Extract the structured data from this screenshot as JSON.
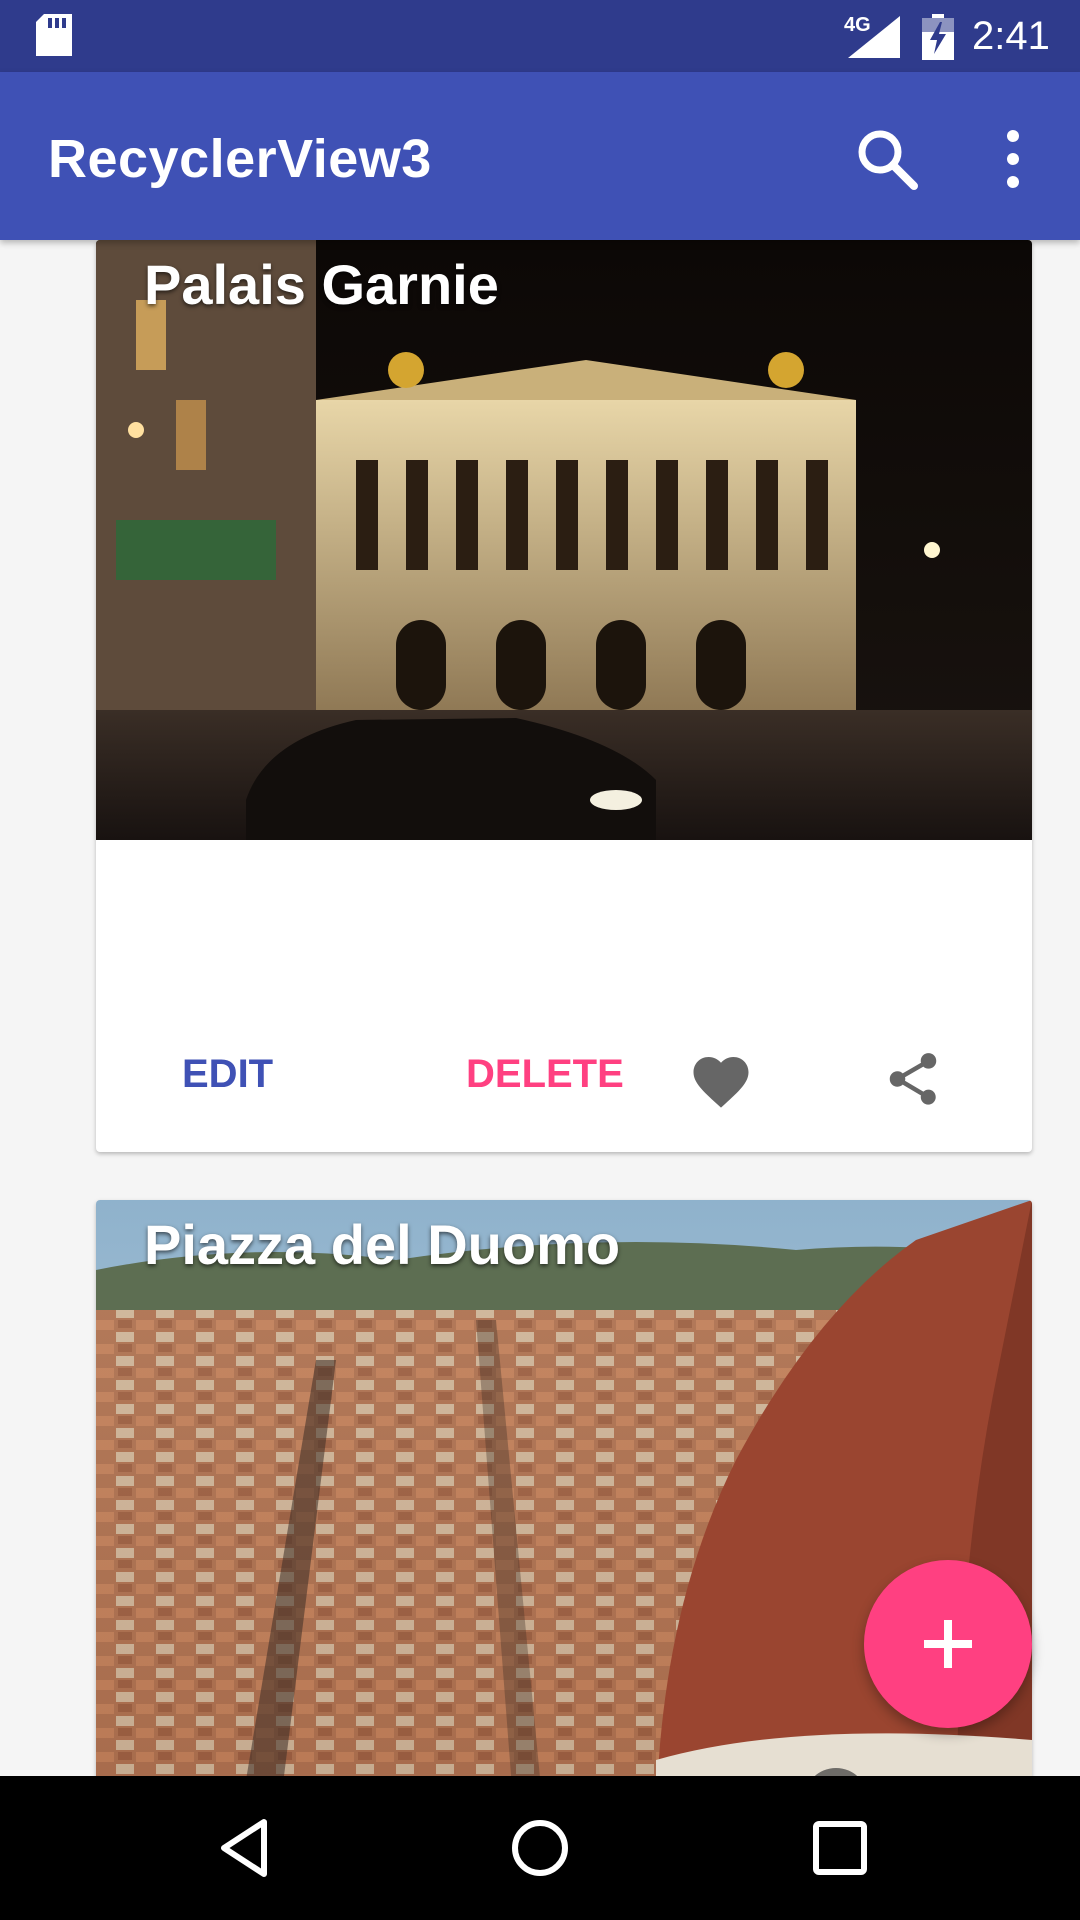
{
  "status_bar": {
    "network": "4G",
    "time": "2:41"
  },
  "app_bar": {
    "title": "RecyclerView3",
    "icons": [
      "search-icon",
      "more-vert-icon"
    ]
  },
  "cards": [
    {
      "title": "Palais Garnie",
      "edit_label": "EDIT",
      "delete_label": "DELETE",
      "icons": [
        "heart-icon",
        "share-icon"
      ]
    },
    {
      "title": "Piazza del Duomo"
    }
  ],
  "fab": {
    "icon": "plus-icon"
  },
  "nav_bar": {
    "icons": [
      "back-icon",
      "home-icon",
      "recents-icon"
    ]
  },
  "colors": {
    "primary": "#3f51b5",
    "primary_dark": "#2f3b8c",
    "accent": "#ff4081"
  }
}
